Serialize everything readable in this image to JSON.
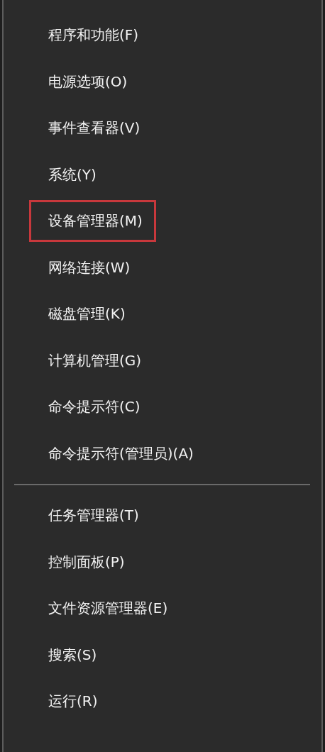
{
  "menu": {
    "groups": [
      {
        "items": [
          {
            "label": "程序和功能(F)",
            "highlighted": false
          },
          {
            "label": "电源选项(O)",
            "highlighted": false
          },
          {
            "label": "事件查看器(V)",
            "highlighted": false
          },
          {
            "label": "系统(Y)",
            "highlighted": false
          },
          {
            "label": "设备管理器(M)",
            "highlighted": true
          },
          {
            "label": "网络连接(W)",
            "highlighted": false
          },
          {
            "label": "磁盘管理(K)",
            "highlighted": false
          },
          {
            "label": "计算机管理(G)",
            "highlighted": false
          },
          {
            "label": "命令提示符(C)",
            "highlighted": false
          },
          {
            "label": "命令提示符(管理员)(A)",
            "highlighted": false
          }
        ]
      },
      {
        "items": [
          {
            "label": "任务管理器(T)",
            "highlighted": false
          },
          {
            "label": "控制面板(P)",
            "highlighted": false
          },
          {
            "label": "文件资源管理器(E)",
            "highlighted": false
          },
          {
            "label": "搜索(S)",
            "highlighted": false
          },
          {
            "label": "运行(R)",
            "highlighted": false
          }
        ]
      }
    ]
  }
}
